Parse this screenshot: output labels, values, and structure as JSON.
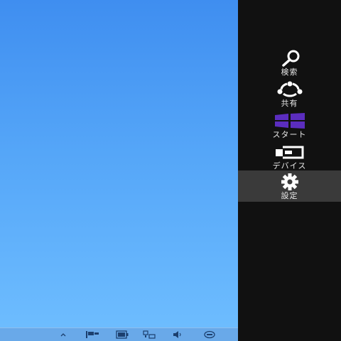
{
  "charms": [
    {
      "label": "検索",
      "icon": "search-icon"
    },
    {
      "label": "共有",
      "icon": "share-icon"
    },
    {
      "label": "スタート",
      "icon": "windows-logo-icon"
    },
    {
      "label": "デバイス",
      "icon": "devices-icon"
    },
    {
      "label": "設定",
      "icon": "gear-icon"
    }
  ],
  "taskbar": {
    "icons": [
      "chevron-up-icon",
      "flag-icon",
      "battery-icon",
      "network-icon",
      "speaker-icon",
      "keyboard-icon"
    ]
  },
  "colors": {
    "desktop_top": "#3f8ef0",
    "desktop_bottom": "#6fbeff",
    "charms_bar": "#111111",
    "charm_active": "#3a3a3a",
    "start_logo": "#5b2dbf"
  }
}
